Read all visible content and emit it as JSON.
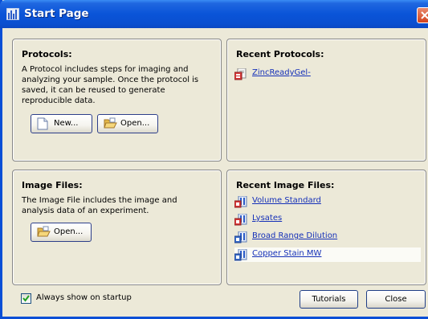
{
  "window": {
    "title": "Start Page"
  },
  "protocols": {
    "title": "Protocols:",
    "description": "A Protocol includes steps for imaging and analyzing your sample. Once the protocol is saved, it can be reused to generate reproducible data.",
    "new_label": "New...",
    "open_label": "Open..."
  },
  "recent_protocols": {
    "title": "Recent Protocols:",
    "items": [
      {
        "label": "ZincReadyGel-"
      }
    ]
  },
  "image_files": {
    "title": "Image Files:",
    "description": "The Image File includes the image and analysis data of an experiment.",
    "open_label": "Open..."
  },
  "recent_image_files": {
    "title": "Recent Image Files:",
    "items": [
      {
        "label": "Volume Standard"
      },
      {
        "label": "Lysates"
      },
      {
        "label": "Broad Range Dilution"
      },
      {
        "label": "Copper Stain MW"
      }
    ]
  },
  "footer": {
    "always_show_label": "Always show on startup",
    "always_show_checked": true,
    "tutorials_label": "Tutorials",
    "close_label": "Close"
  },
  "colors": {
    "titlebar": "#0a54d8",
    "panel_bg": "#ece9d8",
    "link": "#1530b8",
    "close_button": "#d2421c"
  },
  "icons": {
    "app": "bar-chart-icon",
    "close": "close-x-icon",
    "new": "blank-document-icon",
    "open": "open-folder-icon",
    "protocol": "protocol-icon",
    "image_file": "image-file-icon"
  }
}
